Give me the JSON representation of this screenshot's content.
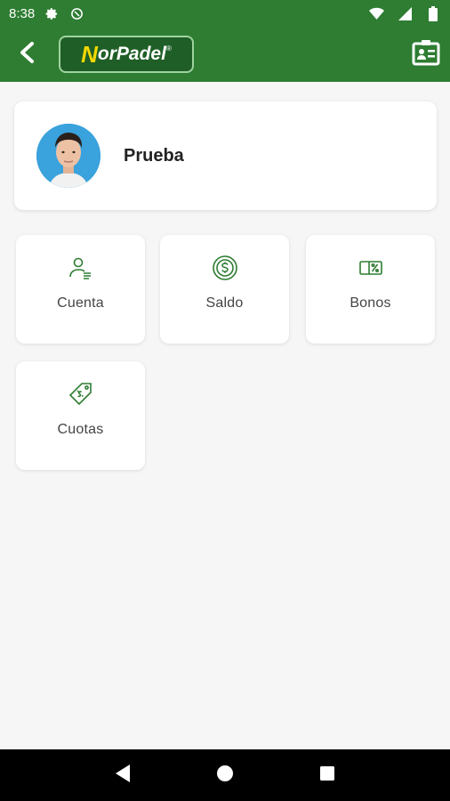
{
  "status_bar": {
    "time": "8:38",
    "icons": [
      "gear-icon",
      "no-sim-icon",
      "wifi-icon",
      "signal-icon",
      "battery-icon"
    ]
  },
  "app_bar": {
    "logo_text_n": "N",
    "logo_text_rest": "orPadel",
    "logo_reg": "®",
    "back_icon": "chevron-left-icon",
    "id_card_icon": "id-card-icon"
  },
  "profile": {
    "name": "Prueba"
  },
  "tiles": [
    {
      "label": "Cuenta",
      "icon": "user-list-icon"
    },
    {
      "label": "Saldo",
      "icon": "coin-dollar-icon"
    },
    {
      "label": "Bonos",
      "icon": "voucher-percent-icon"
    },
    {
      "label": "Cuotas",
      "icon": "price-tag-icon"
    }
  ],
  "colors": {
    "brand_green": "#2e7d32",
    "logo_yellow": "#f3d700",
    "avatar_bg": "#3aa2dc"
  },
  "nav_bar": {
    "buttons": [
      "back-triangle-icon",
      "home-circle-icon",
      "recents-square-icon"
    ]
  }
}
